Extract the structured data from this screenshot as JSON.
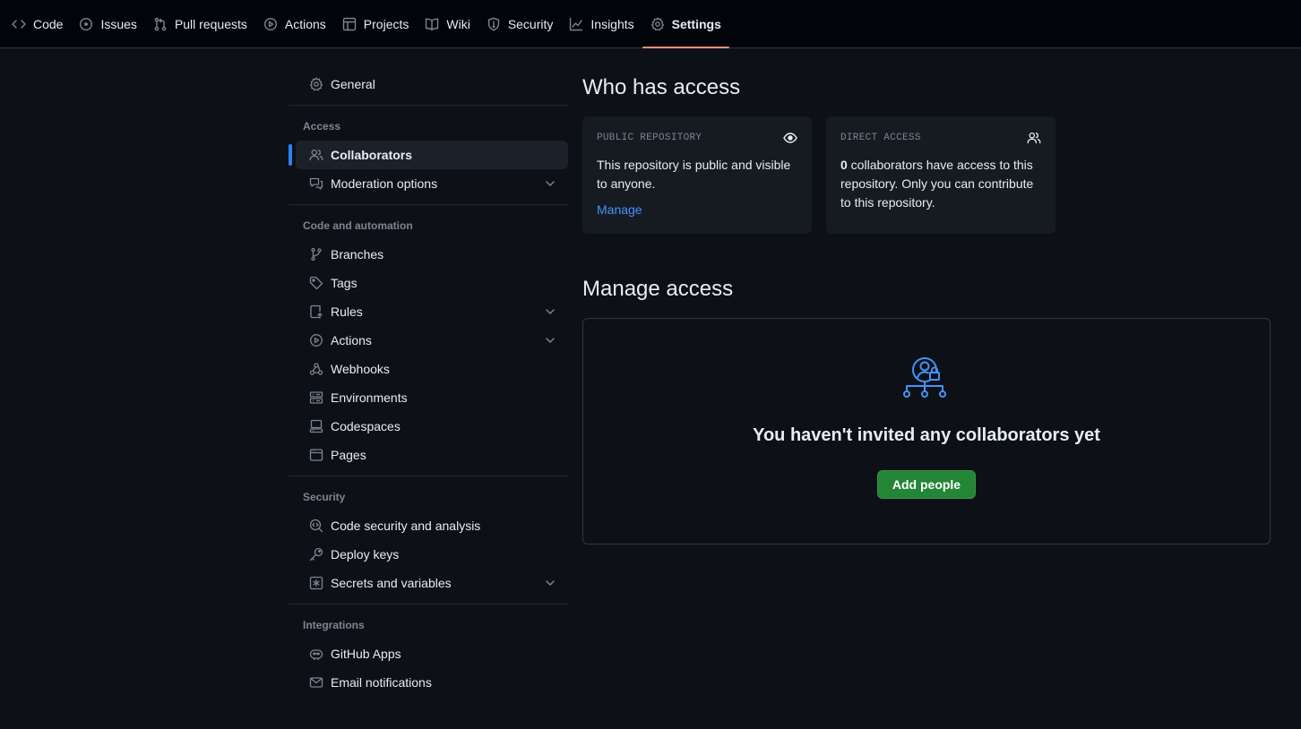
{
  "repo_nav": {
    "tabs": [
      {
        "label": "Code",
        "icon": "code-icon"
      },
      {
        "label": "Issues",
        "icon": "issue-opened-icon"
      },
      {
        "label": "Pull requests",
        "icon": "git-pull-request-icon"
      },
      {
        "label": "Actions",
        "icon": "play-icon"
      },
      {
        "label": "Projects",
        "icon": "table-icon"
      },
      {
        "label": "Wiki",
        "icon": "book-icon"
      },
      {
        "label": "Security",
        "icon": "shield-icon"
      },
      {
        "label": "Insights",
        "icon": "graph-icon"
      },
      {
        "label": "Settings",
        "icon": "gear-icon",
        "active": true
      }
    ],
    "active_color": "#fd8c73"
  },
  "sidebar": {
    "general": "General",
    "access_heading": "Access",
    "collaborators": "Collaborators",
    "moderation": "Moderation options",
    "code_heading": "Code and automation",
    "branches": "Branches",
    "tags": "Tags",
    "rules": "Rules",
    "actions": "Actions",
    "webhooks": "Webhooks",
    "environments": "Environments",
    "codespaces": "Codespaces",
    "pages": "Pages",
    "security_heading": "Security",
    "code_security": "Code security and analysis",
    "deploy_keys": "Deploy keys",
    "secrets": "Secrets and variables",
    "integrations_heading": "Integrations",
    "github_apps": "GitHub Apps",
    "email_notifications": "Email notifications",
    "active_indicator_color": "#2f81f7"
  },
  "who_has_access": {
    "title": "Who has access",
    "public_card": {
      "title": "PUBLIC REPOSITORY",
      "text": "This repository is public and visible to anyone.",
      "link": "Manage"
    },
    "direct_card": {
      "title": "DIRECT ACCESS",
      "count": "0",
      "text": " collaborators have access to this repository. Only you can contribute to this repository."
    }
  },
  "manage_access": {
    "title": "Manage access",
    "empty_message": "You haven't invited any collaborators yet",
    "add_button": "Add people",
    "button_color": "#238636"
  }
}
